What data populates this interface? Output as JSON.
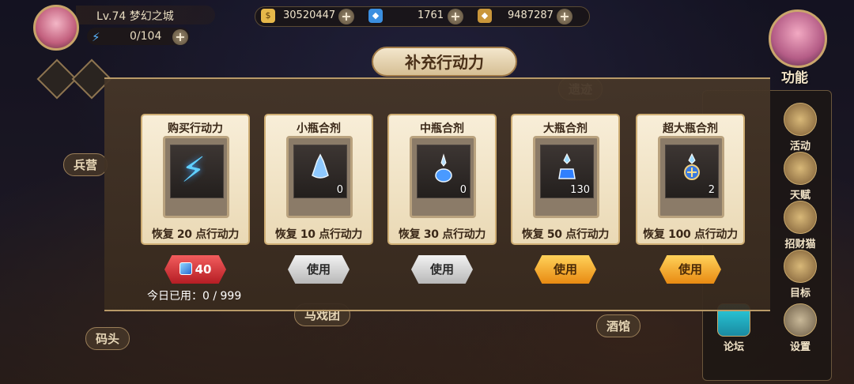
{
  "player": {
    "level": "Lv.74",
    "city": "梦幻之城",
    "stamina": "0/104"
  },
  "resources": [
    {
      "icon": "gold-coin-icon",
      "value": "30520447"
    },
    {
      "icon": "blue-crystal-icon",
      "value": "1761"
    },
    {
      "icon": "gold-ore-icon",
      "value": "9487287"
    }
  ],
  "map_labels": {
    "barracks": "兵营",
    "dock": "码头",
    "circus": "马戏团",
    "tavern": "酒馆",
    "ruins": "遗迹"
  },
  "side_menu": {
    "func_label": "功能",
    "items": [
      {
        "label": "活动",
        "icon": "event-icon"
      },
      {
        "label": "天赋",
        "icon": "talent-icon"
      },
      {
        "label": "招财猫",
        "icon": "lucky-cat-icon"
      },
      {
        "label": "目标",
        "icon": "goal-icon"
      },
      {
        "label": "论坛",
        "icon": "tap-forum-icon"
      },
      {
        "label": "设置",
        "icon": "settings-gear-icon"
      }
    ]
  },
  "modal": {
    "title": "补充行动力",
    "cards": [
      {
        "name": "购买行动力",
        "qty": "",
        "effect": "恢复 20 点行动力",
        "button": "40",
        "button_style": "red"
      },
      {
        "name": "小瓶合剂",
        "qty": "0",
        "effect": "恢复 10 点行动力",
        "button": "使用",
        "button_style": "gray"
      },
      {
        "name": "中瓶合剂",
        "qty": "0",
        "effect": "恢复 30 点行动力",
        "button": "使用",
        "button_style": "gray"
      },
      {
        "name": "大瓶合剂",
        "qty": "130",
        "effect": "恢复 50 点行动力",
        "button": "使用",
        "button_style": "gold"
      },
      {
        "name": "超大瓶合剂",
        "qty": "2",
        "effect": "恢复 100 点行动力",
        "button": "使用",
        "button_style": "gold"
      }
    ],
    "used_today": "今日已用：0 / 999"
  },
  "colors": {
    "accent_gold": "#cfae74",
    "button_red": "#c9252d",
    "button_gold": "#f0a021"
  }
}
